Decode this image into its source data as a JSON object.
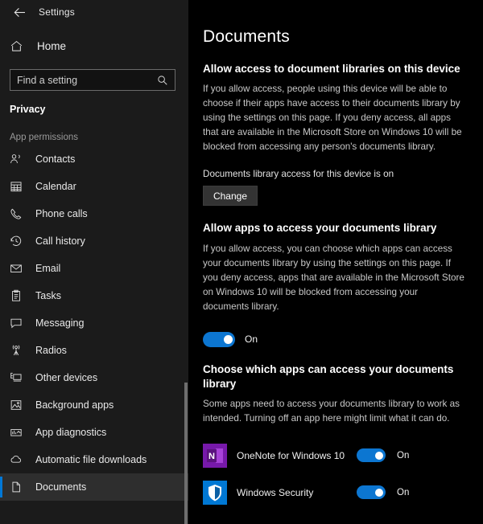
{
  "window": {
    "back_label": "back-arrow",
    "title": "Settings"
  },
  "sidebar": {
    "home_label": "Home",
    "search": {
      "placeholder": "Find a setting",
      "value": ""
    },
    "category_heading": "Privacy",
    "group_heading": "App permissions",
    "accent_color": "#0078d7",
    "items": [
      {
        "label": "Contacts",
        "icon": "contacts-icon",
        "selected": false
      },
      {
        "label": "Calendar",
        "icon": "calendar-icon",
        "selected": false
      },
      {
        "label": "Phone calls",
        "icon": "phone-icon",
        "selected": false
      },
      {
        "label": "Call history",
        "icon": "clock-history-icon",
        "selected": false
      },
      {
        "label": "Email",
        "icon": "envelope-icon",
        "selected": false
      },
      {
        "label": "Tasks",
        "icon": "clipboard-icon",
        "selected": false
      },
      {
        "label": "Messaging",
        "icon": "chat-bubble-icon",
        "selected": false
      },
      {
        "label": "Radios",
        "icon": "radio-tower-icon",
        "selected": false
      },
      {
        "label": "Other devices",
        "icon": "other-devices-icon",
        "selected": false
      },
      {
        "label": "Background apps",
        "icon": "background-apps-icon",
        "selected": false
      },
      {
        "label": "App diagnostics",
        "icon": "app-diagnostics-icon",
        "selected": false
      },
      {
        "label": "Automatic file downloads",
        "icon": "cloud-download-icon",
        "selected": false
      },
      {
        "label": "Documents",
        "icon": "document-icon",
        "selected": true
      }
    ]
  },
  "main": {
    "page_title": "Documents",
    "section_device": {
      "heading": "Allow access to document libraries on this device",
      "body": "If you allow access, people using this device will be able to choose if their apps have access to their documents library by using the settings on this page. If you deny access, all apps that are available in the Microsoft Store on Windows 10 will be blocked from accessing any person's documents library.",
      "status": "Documents library access for this device is on",
      "change_label": "Change"
    },
    "section_apps": {
      "heading": "Allow apps to access your documents library",
      "body": "If you allow access, you can choose which apps can access your documents library by using the settings on this page. If you deny access, apps that are available in the Microsoft Store on Windows 10 will be blocked from accessing your documents library.",
      "toggle_state": "On"
    },
    "section_choose": {
      "heading": "Choose which apps can access your documents library",
      "body": "Some apps need to access your documents library to work as intended. Turning off an app here might limit what it can do.",
      "apps": [
        {
          "name": "OneNote for Windows 10",
          "icon": "onenote-icon",
          "icon_color": "#7719aa",
          "toggle_state": "On"
        },
        {
          "name": "Windows Security",
          "icon": "windows-security-icon",
          "icon_color": "#0078d4",
          "toggle_state": "On"
        }
      ]
    }
  },
  "colors": {
    "accent": "#0078d7",
    "toggle_on": "#0c76d1",
    "sidebar_bg": "#1b1b1b",
    "main_bg": "#000000",
    "selected_bg": "#2e2e2e"
  }
}
